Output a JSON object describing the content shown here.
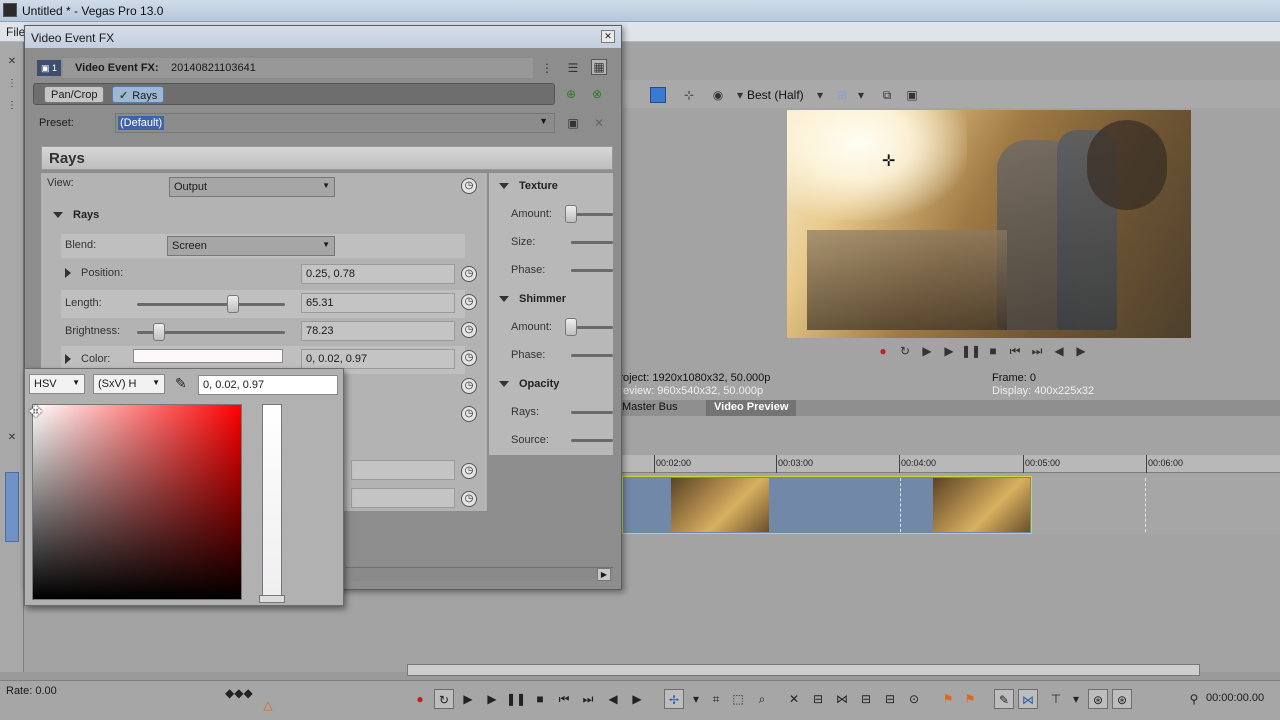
{
  "app": {
    "title": "Untitled * - Vegas Pro 13.0",
    "menu_first": "File"
  },
  "fx_dialog": {
    "title": "Video Event FX",
    "header_label": "Video Event FX:",
    "event_id": "20140821103641",
    "chain": [
      {
        "label": "Pan/Crop",
        "active": false
      },
      {
        "label": "Rays",
        "active": true
      }
    ],
    "preset_label": "Preset:",
    "preset_value": "(Default)",
    "plugin_name": "Rays",
    "view_label": "View:",
    "view_value": "Output",
    "rays_section": "Rays",
    "blend_label": "Blend:",
    "blend_value": "Screen",
    "position_label": "Position:",
    "position_value": "0.25, 0.78",
    "length_label": "Length:",
    "length_value": "65.31",
    "brightness_label": "Brightness:",
    "brightness_value": "78.23",
    "color_label": "Color:",
    "color_value": "0, 0.02, 0.97",
    "texture_section": "Texture",
    "texture_amount": "Amount:",
    "texture_size": "Size:",
    "texture_phase": "Phase:",
    "shimmer_section": "Shimmer",
    "shimmer_amount": "Amount:",
    "shimmer_phase": "Phase:",
    "opacity_section": "Opacity",
    "opacity_rays": "Rays:",
    "opacity_source": "Source:"
  },
  "color_picker": {
    "mode": "HSV",
    "axis": "(SxV) H",
    "value": "0, 0.02, 0.97"
  },
  "preview": {
    "quality": "Best (Half)",
    "project_label": "Project:",
    "project_value": "1920x1080x32, 50.000p",
    "preview_label": "Preview:",
    "preview_value": "960x540x32, 50.000p",
    "frame_label": "Frame:",
    "frame_value": "0",
    "display_label": "Display:",
    "display_value": "400x225x32",
    "tab_master": "Master Bus",
    "tab_video_preview": "Video Preview"
  },
  "timeline": {
    "ticks": [
      "00:02:00",
      "00:03:00",
      "00:04:00",
      "00:05:00",
      "00:06:00"
    ],
    "rate": "Rate: 0.00",
    "timecode": "00:00:00.00"
  }
}
